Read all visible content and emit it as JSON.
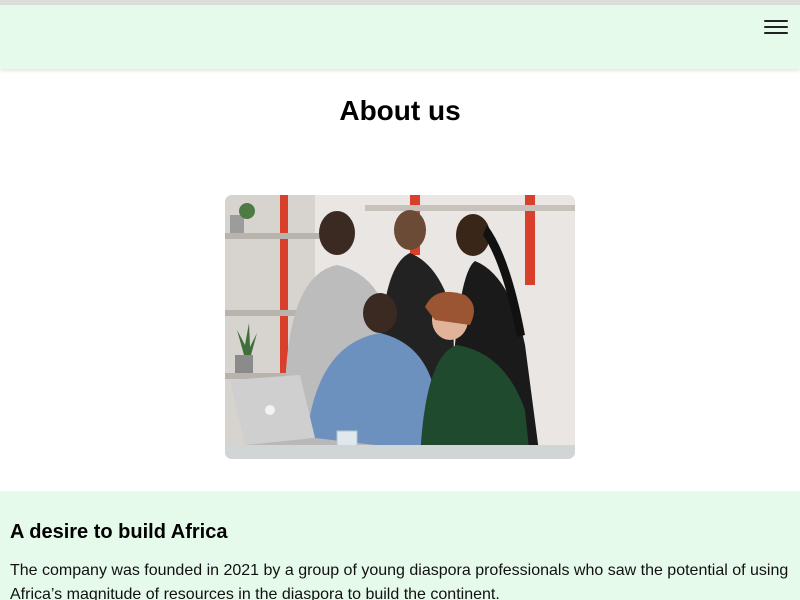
{
  "header": {
    "menu_icon": "hamburger-menu-icon",
    "background": "#e6faeb"
  },
  "main": {
    "title": "About us",
    "hero_image": {
      "subject": "five-team-members-around-laptop"
    }
  },
  "about": {
    "heading": "A desire to build Africa",
    "body": "The company was founded in 2021 by a group of young diaspora professionals who saw the potential of using Africa’s magnitude of resources in the diaspora to build the continent.",
    "background": "#e6faeb"
  }
}
